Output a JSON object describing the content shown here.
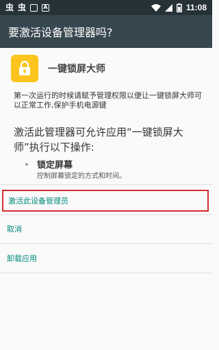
{
  "status_bar": {
    "time": "11:08",
    "notification_icons": [
      "bug-icon",
      "bug-icon",
      "notification-box-icon",
      "notification-a-icon"
    ],
    "notification_glyphs": [
      "虫",
      "虫",
      "",
      "A"
    ],
    "system_icons": [
      "wifi-icon",
      "signal-icon",
      "battery-icon"
    ]
  },
  "app_bar": {
    "title": "要激活设备管理器吗?"
  },
  "app": {
    "icon": "lock-icon",
    "icon_color": "#fcc41c",
    "name": "一键锁屏大师"
  },
  "description": "第一次运行的时候请赋予管理权限以便让一键锁屏大师可以正常工作,保护手机电源键",
  "warning": "激活此管理器可允许应用“一键锁屏大师”执行以下操作:",
  "policies": [
    {
      "title": "锁定屏幕",
      "description": "控制屏幕锁定的方式和时间。"
    }
  ],
  "actions": {
    "activate": "激活此设备管理员",
    "cancel": "取消",
    "uninstall": "卸载应用"
  },
  "colors": {
    "status_bar": "#263238",
    "app_bar": "#37474f",
    "accent": "#00897b",
    "highlight_border": "#d32f2f"
  }
}
